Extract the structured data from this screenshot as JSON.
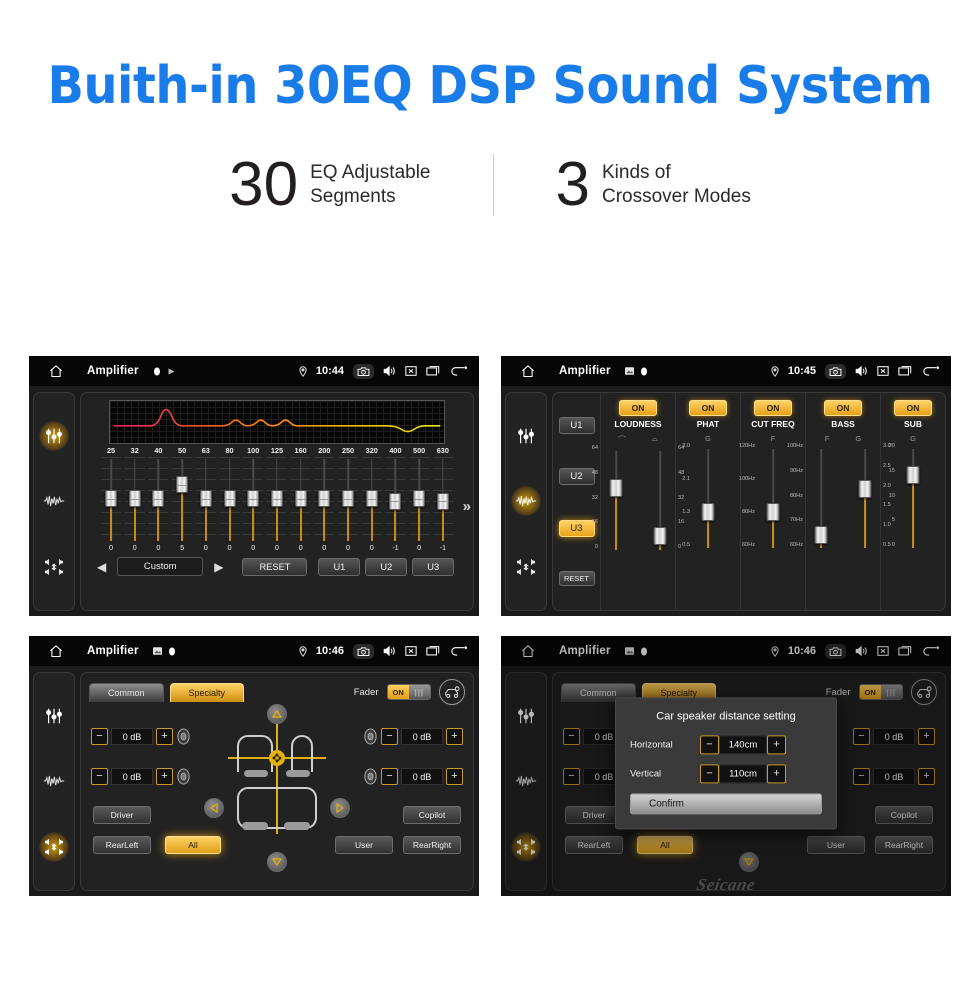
{
  "hero": {
    "title": "Buith-in 30EQ DSP Sound System",
    "title_color": "#1a7ce8"
  },
  "stats": [
    {
      "number": "30",
      "line1": "EQ Adjustable",
      "line2": "Segments"
    },
    {
      "number": "3",
      "line1": "Kinds of",
      "line2": "Crossover Modes"
    }
  ],
  "colors": {
    "amber": "#e8a41b",
    "amber_light": "#ffd166",
    "panel_bg": "#222222",
    "rail_bg": "#232323"
  },
  "statusbar": {
    "title": "Amplifier",
    "home_icon": "home-icon",
    "camera_icon": "camera-icon",
    "volume_icon": "volume-icon",
    "close_icon": "close-box-icon",
    "recents_icon": "recent-apps-icon",
    "back_icon": "back-arrow-icon",
    "location_icon": "location-pin-icon"
  },
  "rail": {
    "icons": [
      "eq-sliders-icon",
      "waveform-icon",
      "balance-fader-icon"
    ]
  },
  "panel1": {
    "time": "10:44",
    "active_rail": 0,
    "frequencies": [
      "25",
      "32",
      "40",
      "50",
      "63",
      "80",
      "100",
      "125",
      "160",
      "200",
      "250",
      "320",
      "400",
      "500",
      "630"
    ],
    "values": [
      "0",
      "0",
      "0",
      "5",
      "0",
      "0",
      "0",
      "0",
      "0",
      "0",
      "0",
      "0",
      "-1",
      "0",
      "-1"
    ],
    "preset": "Custom",
    "prev_label": "◀",
    "next_label": "▶",
    "reset_label": "RESET",
    "user_presets": [
      "U1",
      "U2",
      "U3"
    ],
    "expand_label": "»",
    "curve_colors": [
      "#ea1e63",
      "#f05a20",
      "#f58a10",
      "#f0c010",
      "#e8e818"
    ]
  },
  "panel2": {
    "time": "10:45",
    "active_rail": 1,
    "user_buttons": [
      "U1",
      "U2",
      "U3"
    ],
    "active_user": "U3",
    "reset_label": "RESET",
    "columns": [
      {
        "name": "LOUDNESS",
        "toggle": "ON",
        "sub_labels": [
          "⌒",
          "⌓"
        ],
        "sliders": [
          {
            "scale": [
              "64",
              "48",
              "32",
              "16",
              "0"
            ],
            "scale_side": "left",
            "pos": 0.62
          },
          {
            "scale": [
              "64",
              "48",
              "32",
              "16",
              "0"
            ],
            "scale_side": "right",
            "pos": 0.04
          }
        ]
      },
      {
        "name": "PHAT",
        "toggle": "ON",
        "sub_labels": [
          "G"
        ],
        "sliders": [
          {
            "scale": [
              "3.0",
              "2.1",
              "1.3",
              "0.5"
            ],
            "scale_side": "left",
            "pos": 0.3
          }
        ]
      },
      {
        "name": "CUT FREQ",
        "toggle": "ON",
        "sub_labels": [
          "F"
        ],
        "sliders": [
          {
            "scale": [
              "120Hz",
              "100Hz",
              "80Hz",
              "60Hz"
            ],
            "scale_side": "left",
            "pos": 0.3
          }
        ]
      },
      {
        "name": "BASS",
        "toggle": "ON",
        "sub_labels": [
          "F",
          "G"
        ],
        "sliders": [
          {
            "scale": [
              "100Hz",
              "90Hz",
              "80Hz",
              "70Hz",
              "60Hz"
            ],
            "scale_side": "left",
            "pos": 0.03
          },
          {
            "scale": [
              "3.0",
              "2.5",
              "2.0",
              "1.5",
              "1.0",
              "0.5"
            ],
            "scale_side": "right",
            "pos": 0.58
          }
        ]
      },
      {
        "name": "SUB",
        "toggle": "ON",
        "sub_labels": [
          "G"
        ],
        "sliders": [
          {
            "scale": [
              "20",
              "15",
              "10",
              "5",
              "0"
            ],
            "scale_side": "left",
            "pos": 0.76
          }
        ]
      }
    ]
  },
  "panel3": {
    "time": "10:46",
    "active_rail": 2,
    "tabs": [
      {
        "label": "Common",
        "active": false
      },
      {
        "label": "Specialty",
        "active": true
      }
    ],
    "fader_label": "Fader",
    "fader_toggle_on": "ON",
    "car_settings_icon": "car-speaker-icon",
    "steppers": [
      {
        "id": "front-left",
        "value": "0 dB",
        "minus": "−",
        "plus": "+"
      },
      {
        "id": "rear-left",
        "value": "0 dB",
        "minus": "−",
        "plus": "+"
      },
      {
        "id": "front-right",
        "value": "0 dB",
        "minus": "−",
        "plus": "+"
      },
      {
        "id": "rear-right",
        "value": "0 dB",
        "minus": "−",
        "plus": "+"
      }
    ],
    "position_buttons": [
      {
        "label": "Driver",
        "active": false
      },
      {
        "label": "Copilot",
        "active": false
      },
      {
        "label": "RearLeft",
        "active": false
      },
      {
        "label": "All",
        "active": true
      },
      {
        "label": "User",
        "active": false
      },
      {
        "label": "RearRight",
        "active": false
      }
    ]
  },
  "panel4": {
    "time": "10:46",
    "active_rail": 2,
    "tabs": [
      {
        "label": "Common",
        "active": false
      },
      {
        "label": "Specialty",
        "active": true
      }
    ],
    "fader_label": "Fader",
    "fader_toggle_on": "ON",
    "modal": {
      "title": "Car speaker distance setting",
      "rows": [
        {
          "label": "Horizontal",
          "value": "140cm",
          "minus": "−",
          "plus": "+"
        },
        {
          "label": "Vertical",
          "value": "110cm",
          "minus": "−",
          "plus": "+"
        }
      ],
      "confirm_label": "Confirm"
    },
    "watermark": "Seicane"
  }
}
